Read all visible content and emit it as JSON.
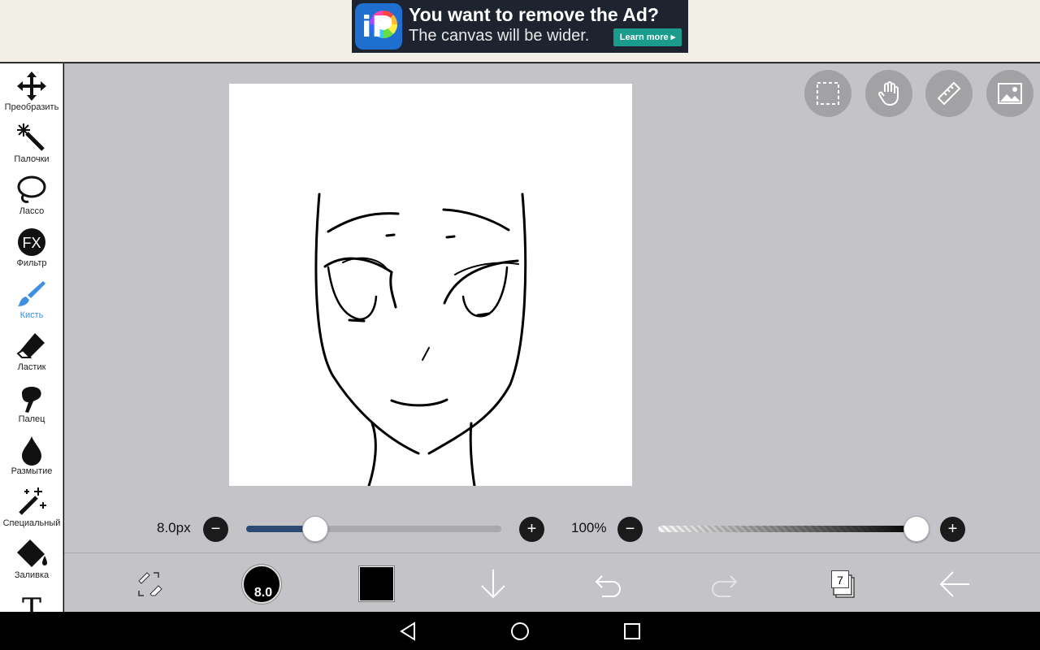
{
  "ad": {
    "title": "You want to remove the Ad?",
    "subtitle": "The canvas will be wider.",
    "button": "Learn more ▸",
    "logo_text": "iP"
  },
  "toolbar": {
    "tools": [
      {
        "label": "Преобразить",
        "icon": "move-icon"
      },
      {
        "label": "Палочки",
        "icon": "magic-wand-icon"
      },
      {
        "label": "Лассо",
        "icon": "lasso-icon"
      },
      {
        "label": "Фильтр",
        "icon": "fx-icon",
        "glyph": "FX"
      },
      {
        "label": "Кисть",
        "icon": "brush-icon",
        "active": true
      },
      {
        "label": "Ластик",
        "icon": "eraser-icon"
      },
      {
        "label": "Палец",
        "icon": "finger-icon"
      },
      {
        "label": "Размытие",
        "icon": "blur-drop-icon"
      },
      {
        "label": "Специальный",
        "icon": "special-icon"
      },
      {
        "label": "Заливка",
        "icon": "fill-icon"
      },
      {
        "label": "",
        "icon": "text-icon",
        "glyph": "T"
      }
    ]
  },
  "brush": {
    "size_label": "8.0px",
    "size_fraction": 0.27,
    "opacity_label": "100%",
    "opacity_fraction": 1.0,
    "circle_value": "8.0"
  },
  "colors": {
    "accent": "#3d8fe0",
    "workspace": "#c4c3c8",
    "slider_fill": "#2c4a73",
    "current_color": "#000000"
  },
  "bottom": {
    "layers_count": "7",
    "icons": [
      "swap-brush-eraser-icon",
      "brush-size-icon",
      "color-swatch-icon",
      "download-arrow-icon",
      "undo-icon",
      "redo-icon",
      "layers-icon",
      "back-arrow-icon"
    ]
  },
  "top_right_buttons": [
    "selection-icon",
    "hand-icon",
    "ruler-icon",
    "image-icon"
  ],
  "navbar": [
    "nav-back-icon",
    "nav-home-icon",
    "nav-recents-icon"
  ]
}
